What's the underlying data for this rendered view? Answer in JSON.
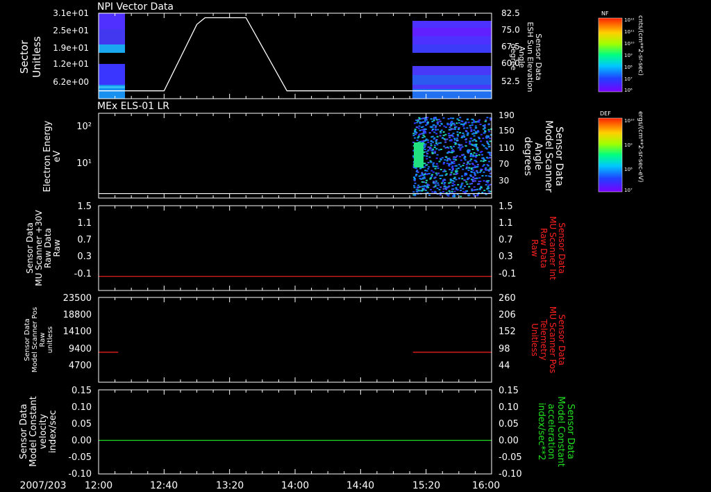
{
  "date_label": "2007/203",
  "time_ticks": [
    "12:00",
    "12:40",
    "13:20",
    "14:00",
    "14:40",
    "15:20",
    "16:00"
  ],
  "chart_data": [
    {
      "type": "heatmap",
      "title": "NPI Vector Data",
      "ylabel": [
        "Sector",
        "Unitless"
      ],
      "y_ticks": [
        "3.1e+01",
        "2.5e+01",
        "1.9e+01",
        "1.2e+01",
        "6.2e+00"
      ],
      "right_ylabel": [
        "Sensor Data",
        "ESH Sun Elevation",
        "Angle",
        "degree"
      ],
      "right_ticks": [
        "82.5",
        "75.0",
        "67.5",
        "60.0",
        "52.5"
      ],
      "right_ylim": [
        46,
        84
      ],
      "line_series": {
        "name": "ESH Sun Elevation Angle",
        "x": [
          "12:00",
          "12:40",
          "13:00",
          "13:05",
          "13:30",
          "13:55",
          "14:00",
          "16:00"
        ],
        "y": [
          49.5,
          49.5,
          79,
          82,
          82,
          49.5,
          49.5,
          49.5
        ]
      },
      "colorbar": {
        "label": "NF",
        "units": "cnts/(cm**2-sr-sec)",
        "ticks": [
          "10¹²",
          "10¹¹",
          "10¹⁰",
          "10⁹",
          "10⁸",
          "10⁷",
          "10⁶"
        ]
      }
    },
    {
      "type": "heatmap",
      "title": "MEx ELS-01 LR",
      "ylabel": [
        "Electron Energy",
        "eV"
      ],
      "y_ticks": [
        "10²",
        "10¹"
      ],
      "right_ylabel": [
        "Sensor Data",
        "Model Scanner",
        "Angle",
        "degrees"
      ],
      "right_ticks": [
        "190",
        "150",
        "110",
        "70",
        "30"
      ],
      "right_ylim": [
        0,
        190
      ],
      "line_series": {
        "name": "Model Scanner Angle",
        "x": [
          "12:00",
          "16:00"
        ],
        "y": [
          10,
          10
        ]
      },
      "colorbar": {
        "label": "DEF",
        "units": "ergs/(cm**2-sr-sec-eV)",
        "ticks": [
          "10¹⁰",
          "10⁹",
          "10⁸",
          "10⁷"
        ]
      }
    },
    {
      "type": "line",
      "ylabel": [
        "Sensor Data",
        "MU Scanner +30V",
        "Raw Data",
        "Raw"
      ],
      "y_ticks": [
        "1.5",
        "1.1",
        "0.7",
        "0.3",
        "-0.1"
      ],
      "right_ylabel": [
        "Sensor Data",
        "MU Scanner Int",
        "Raw Data",
        "Raw"
      ],
      "right_ticks": [
        "1.5",
        "1.1",
        "0.7",
        "0.3",
        "-0.1"
      ],
      "ylim": [
        -0.3,
        1.5
      ],
      "series": [
        {
          "name": "MU Scanner Int Raw Data",
          "x": [
            "12:00",
            "16:00"
          ],
          "y": [
            0.0,
            0.0
          ],
          "color": "#ff2020"
        }
      ]
    },
    {
      "type": "line",
      "ylabel": [
        "Sensor Data",
        "Model Scanner Pos",
        "Raw",
        "unitless"
      ],
      "y_ticks": [
        "23500",
        "18800",
        "14100",
        "9400",
        "4700"
      ],
      "right_ylabel": [
        "Sensor Data",
        "MU Scanner Pos",
        "Telemetry",
        "Unitless"
      ],
      "right_ticks": [
        "260",
        "206",
        "152",
        "98",
        "44"
      ],
      "ylim": [
        0,
        23500
      ],
      "series": [
        {
          "name": "MU Scanner Pos Telemetry",
          "segments": [
            {
              "x": [
                "12:00",
                "12:12"
              ],
              "y": [
                8300,
                8300
              ]
            },
            {
              "x": [
                "15:12",
                "16:00"
              ],
              "y": [
                8300,
                8300
              ]
            }
          ],
          "color": "#ff2020"
        }
      ]
    },
    {
      "type": "line",
      "ylabel": [
        "Sensor Data",
        "Model Constant",
        "velocity",
        "index/sec"
      ],
      "y_ticks": [
        "0.15",
        "0.10",
        "0.05",
        "0.00",
        "-0.05",
        "-0.10"
      ],
      "right_ylabel": [
        "Sensor Data",
        "Model Constant",
        "acceleration",
        "index/sec**2"
      ],
      "right_ticks": [
        "0.15",
        "0.10",
        "0.05",
        "0.00",
        "-0.05",
        "-0.10"
      ],
      "ylim": [
        -0.1,
        0.15
      ],
      "series": [
        {
          "name": "Model Constant acceleration",
          "x": [
            "12:00",
            "16:00"
          ],
          "y": [
            0.0,
            0.0
          ],
          "color": "#20e020"
        }
      ]
    }
  ]
}
